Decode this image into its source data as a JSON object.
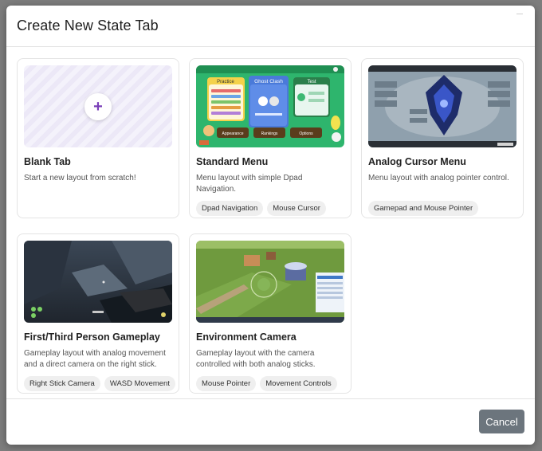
{
  "modal": {
    "title": "Create New State Tab",
    "cancel_label": "Cancel"
  },
  "cards": [
    {
      "title": "Blank Tab",
      "description": "Start a new layout from scratch!",
      "tags": []
    },
    {
      "title": "Standard Menu",
      "description": "Menu layout with simple Dpad Navigation.",
      "tags": [
        "Dpad Navigation",
        "Mouse Cursor"
      ],
      "thumb": {
        "practice": "Practice",
        "ghost_clash": "Ghost Clash",
        "test": "Test",
        "appearance": "Appearance",
        "rankings": "Rankings",
        "options": "Options"
      }
    },
    {
      "title": "Analog Cursor Menu",
      "description": "Menu layout with analog pointer control.",
      "tags": [
        "Gamepad and Mouse Pointer"
      ]
    },
    {
      "title": "First/Third Person Gameplay",
      "description": "Gameplay layout with analog movement and a direct camera on the right stick.",
      "tags": [
        "Right Stick Camera",
        "WASD Movement"
      ]
    },
    {
      "title": "Environment Camera",
      "description": "Gameplay layout with the camera controlled with both analog sticks.",
      "tags": [
        "Mouse Pointer",
        "Movement Controls"
      ]
    }
  ],
  "colors": {
    "accent_plus": "#7a3fb8",
    "cancel_bg": "#6c757d"
  }
}
